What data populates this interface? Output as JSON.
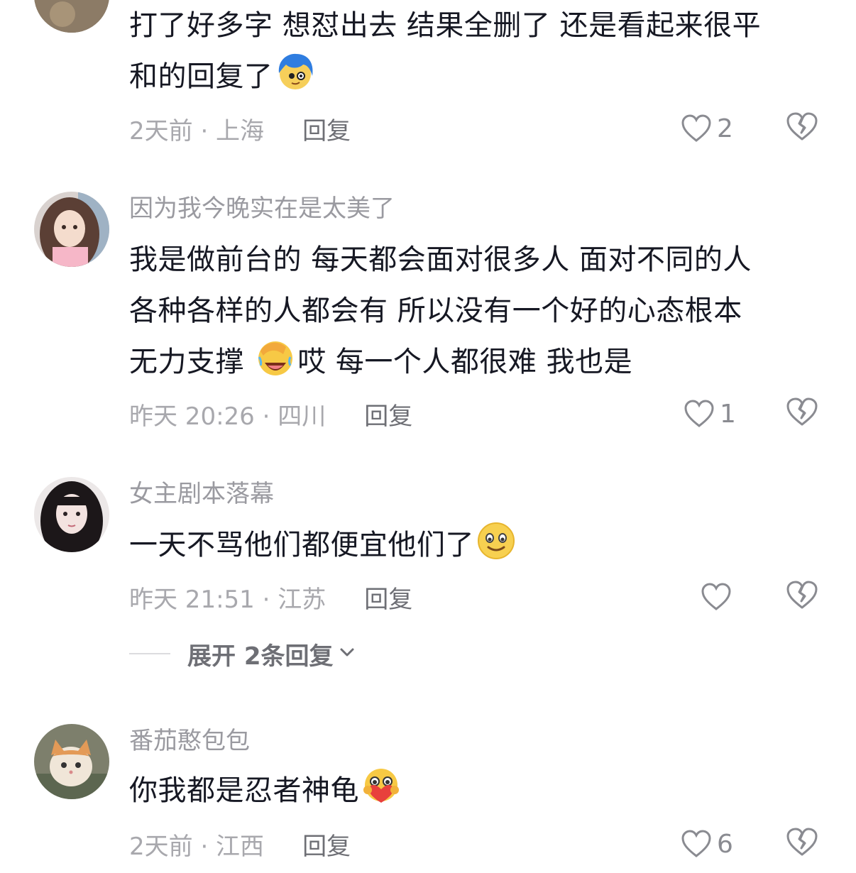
{
  "comments": [
    {
      "username": "",
      "text": [
        "打了好多字 想怼出去 结果全删了 还是看起来很平",
        "和的回复了"
      ],
      "emoji": "blue-hair-face-emoji",
      "time": "2天前 · 上海",
      "reply_label": "回复",
      "likes": "2"
    },
    {
      "username": "因为我今晚实在是太美了",
      "text": [
        "我是做前台的 每天都会面对很多人 面对不同的人",
        "各种各样的人都会有 所以没有一个好的心态根本",
        "无力支撑",
        "哎 每一个人都很难 我也是"
      ],
      "emoji": "facepalm-laugh-emoji",
      "time": "昨天 20:26 · 四川",
      "reply_label": "回复",
      "likes": "1"
    },
    {
      "username": "女主剧本落幕",
      "text": [
        "一天不骂他们都便宜他们了"
      ],
      "emoji": "smile-emoji",
      "time": "昨天 21:51 · 江苏",
      "reply_label": "回复",
      "likes": ""
    },
    {
      "username": "番茄憨包包",
      "text": [
        "你我都是忍者神龟"
      ],
      "emoji": "heart-hug-emoji",
      "time": "2天前 · 江西",
      "reply_label": "回复",
      "likes": "6"
    }
  ],
  "expand_replies": {
    "label": "展开 2条回复"
  },
  "colors": {
    "text": "#161823",
    "secondary": "#a8a8ad",
    "username": "#9a9aa0",
    "reply": "#6e6f75"
  }
}
